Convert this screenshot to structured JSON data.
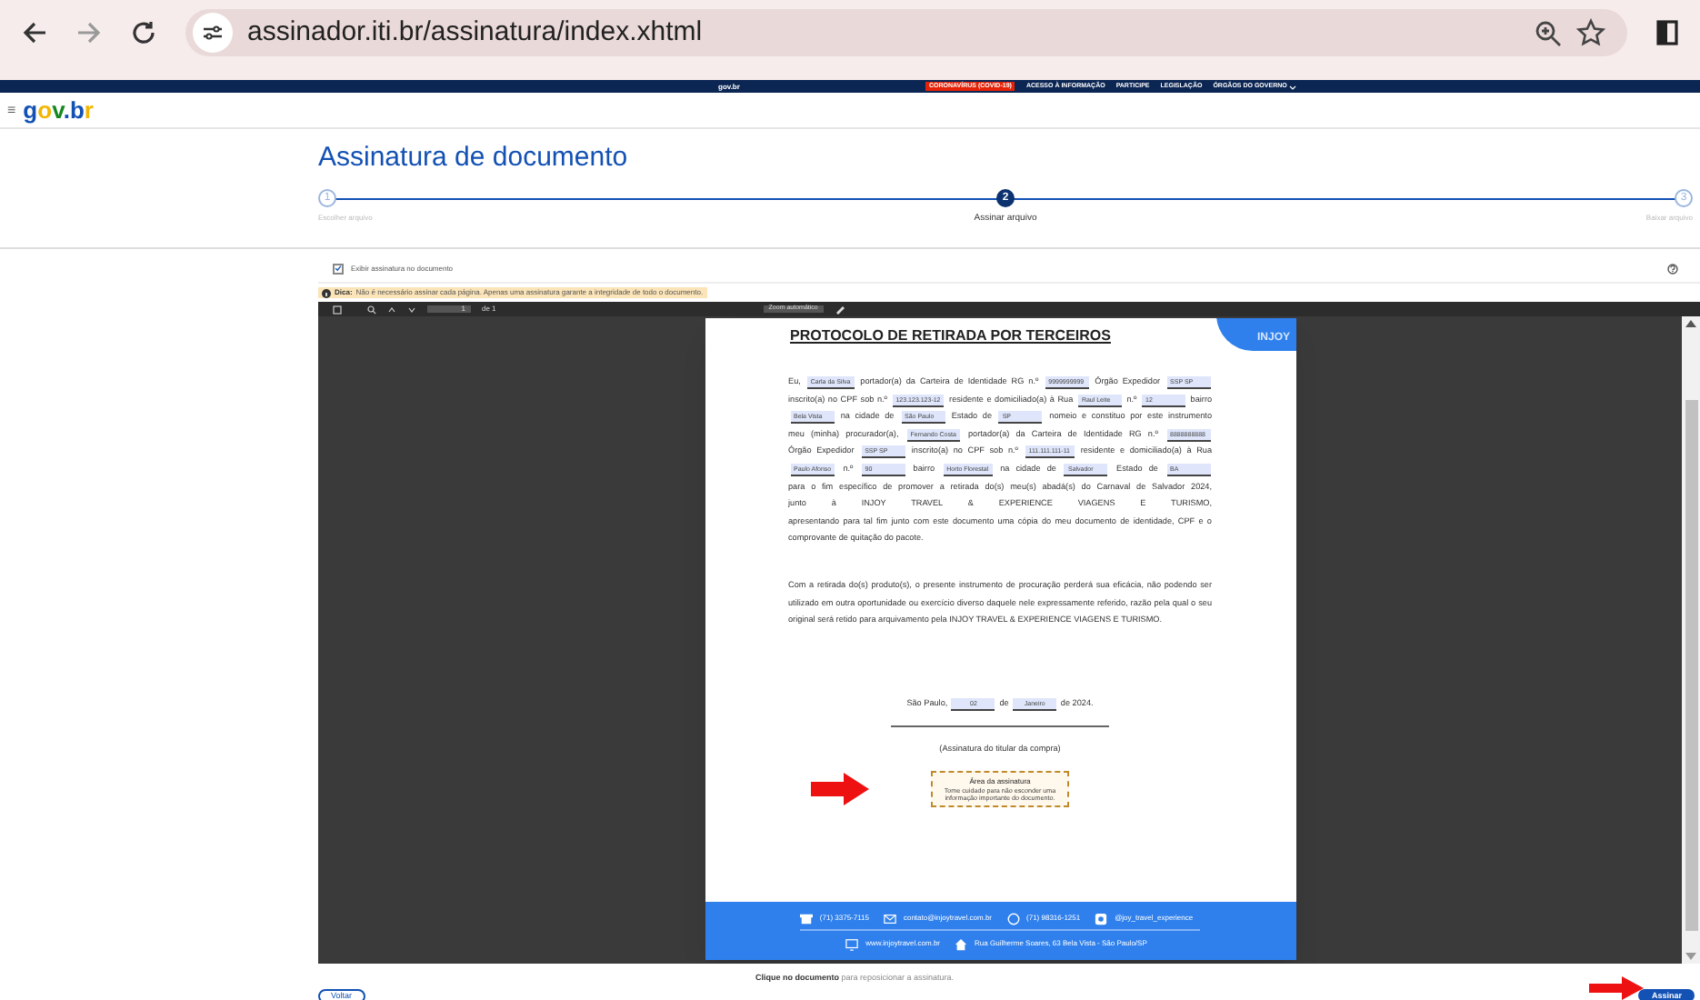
{
  "browser": {
    "url": "assinador.iti.br/assinatura/index.xhtml"
  },
  "gov_bar": {
    "logo": "gov.br",
    "links": [
      {
        "label": "CORONAVÍRUS (COVID-19)",
        "kind": "alert"
      },
      {
        "label": "ACESSO À INFORMAÇÃO",
        "kind": "link"
      },
      {
        "label": "PARTICIPE",
        "kind": "link"
      },
      {
        "label": "LEGISLAÇÃO",
        "kind": "link"
      },
      {
        "label": "ÓRGÃOS DO GOVERNO",
        "kind": "menu",
        "expanded": false
      }
    ]
  },
  "header": {
    "menu": "≡",
    "logo": "gov.br"
  },
  "title": "Assinatura de documento",
  "steps": [
    {
      "number": "1",
      "label": "Escolher arquivo",
      "selected": false
    },
    {
      "number": "2",
      "label": "Assinar arquivo",
      "selected": true
    },
    {
      "number": "3",
      "label": "Baixar arquivo",
      "selected": false
    }
  ],
  "show_signature": {
    "label": "Exibir assinatura no documento",
    "checked": true
  },
  "tip": {
    "label": "Dica:",
    "text": "Não é necessário assinar cada página. Apenas uma assinatura garante a integridade de todo o documento."
  },
  "viewer": {
    "page": "1",
    "page_count": "de 1",
    "zoom": "Zoom automático"
  },
  "document": {
    "badge": "INJOY",
    "title": "PROTOCOLO DE RETIRADA POR TERCEIROS",
    "paragraphs": [
      [
        {
          "kind": "text",
          "text": "Eu,"
        },
        {
          "kind": "field",
          "text": "Carla da Silva"
        },
        {
          "kind": "text",
          "text": "portador(a) da Carteira de Identidade RG n.º"
        },
        {
          "kind": "field",
          "text": "9999999999"
        },
        {
          "kind": "text",
          "text": "Órgão Expedidor"
        },
        {
          "kind": "field",
          "text": "SSP SP"
        },
        {
          "kind": "text",
          "text": "inscrito(a) no CPF sob n.º"
        },
        {
          "kind": "field",
          "text": "123.123.123-12"
        },
        {
          "kind": "text",
          "text": "residente e domiciliado(a) à Rua"
        },
        {
          "kind": "field",
          "text": "Raul Leite"
        },
        {
          "kind": "text",
          "text": "n.º"
        },
        {
          "kind": "field",
          "text": "12"
        },
        {
          "kind": "text",
          "text": "bairro"
        },
        {
          "kind": "field",
          "text": "Bela Vista"
        },
        {
          "kind": "text",
          "text": "na cidade de"
        },
        {
          "kind": "field",
          "text": "São Paulo"
        },
        {
          "kind": "text",
          "text": "Estado de"
        },
        {
          "kind": "field",
          "text": "SP"
        },
        {
          "kind": "text",
          "text": "nomeio e constituo por este instrumento"
        },
        {
          "kind": "text",
          "text": "meu (minha) procurador(a),"
        },
        {
          "kind": "field",
          "text": "Fernando Costa"
        },
        {
          "kind": "text",
          "text": "portador(a) da Carteira de Identidade RG n.º"
        },
        {
          "kind": "field",
          "text": "8888888888"
        },
        {
          "kind": "text",
          "text": "Órgão Expedidor"
        },
        {
          "kind": "field",
          "text": "SSP SP"
        },
        {
          "kind": "text",
          "text": "inscrito(a) no CPF sob n.º"
        },
        {
          "kind": "field",
          "text": "111.111.111-11"
        },
        {
          "kind": "text",
          "text": "residente e domiciliado(a) à Rua"
        },
        {
          "kind": "field",
          "text": "Paulo Afonso"
        },
        {
          "kind": "text",
          "text": "n.º"
        },
        {
          "kind": "field",
          "text": "90"
        },
        {
          "kind": "text",
          "text": "bairro"
        },
        {
          "kind": "field",
          "text": "Horto Florestal"
        },
        {
          "kind": "text",
          "text": "na cidade de"
        },
        {
          "kind": "field",
          "text": "Salvador"
        },
        {
          "kind": "text",
          "text": "Estado de"
        },
        {
          "kind": "field",
          "text": "BA"
        },
        {
          "kind": "text",
          "text": "para o fim específico de promover a retirada do(s)"
        },
        {
          "kind": "text",
          "text": "meu(s) abadá(s) do Carnaval de Salvador 2024,"
        },
        {
          "kind": "text",
          "text": "junto à INJOY TRAVEL & EXPERIENCE VIAGENS E TURISMO,"
        },
        {
          "kind": "text",
          "text": "apresentando para tal fim junto com este documento"
        },
        {
          "kind": "text",
          "text": "uma cópia do meu documento de identidade, CPF e o"
        },
        {
          "kind": "text",
          "text": "comprovante de quitação do pacote."
        }
      ],
      [
        {
          "kind": "text",
          "text": "Com a retirada do(s) produto(s), o presente instrumento de procuração perderá sua eficácia, não podendo ser utilizado em outra oportunidade ou exercício diverso daquele nele expressamente referido, razão pela qual o seu original será retido para arquivamento pela INJOY TRAVEL & EXPERIENCE VIAGENS E TURISMO."
        }
      ]
    ],
    "date_line": [
      {
        "kind": "text",
        "text": "São Paulo,"
      },
      {
        "kind": "field",
        "text": "02"
      },
      {
        "kind": "text",
        "text": "de"
      },
      {
        "kind": "field",
        "text": "Janeiro"
      },
      {
        "kind": "text",
        "text": "de 2024."
      }
    ],
    "signature_caption": "(Assinatura do titular da compra)",
    "signature_area": {
      "title": "Área da assinatura",
      "text": "Tome cuidado para não esconder uma informação importante do documento."
    },
    "footer_rows": [
      [
        {
          "kind": "phone",
          "text": "(71) 3375-7115"
        },
        {
          "kind": "mail",
          "text": "contato@injoytravel.com.br"
        },
        {
          "kind": "whatsapp",
          "text": "(71) 98316-1251"
        },
        {
          "kind": "instagram",
          "text": "@joy_travel_experience"
        }
      ],
      [
        {
          "kind": "web",
          "text": "www.injoytravel.com.br"
        },
        {
          "kind": "home",
          "text": "Rua Guilherme Soares, 63 Bela Vista - São Paulo/SP"
        }
      ]
    ]
  },
  "hint": "**Clique no documento** para reposicionar a assinatura.",
  "buttons": [
    {
      "label": "Voltar",
      "kind": "secondary"
    },
    {
      "label": "Assinar",
      "kind": "primary"
    }
  ]
}
